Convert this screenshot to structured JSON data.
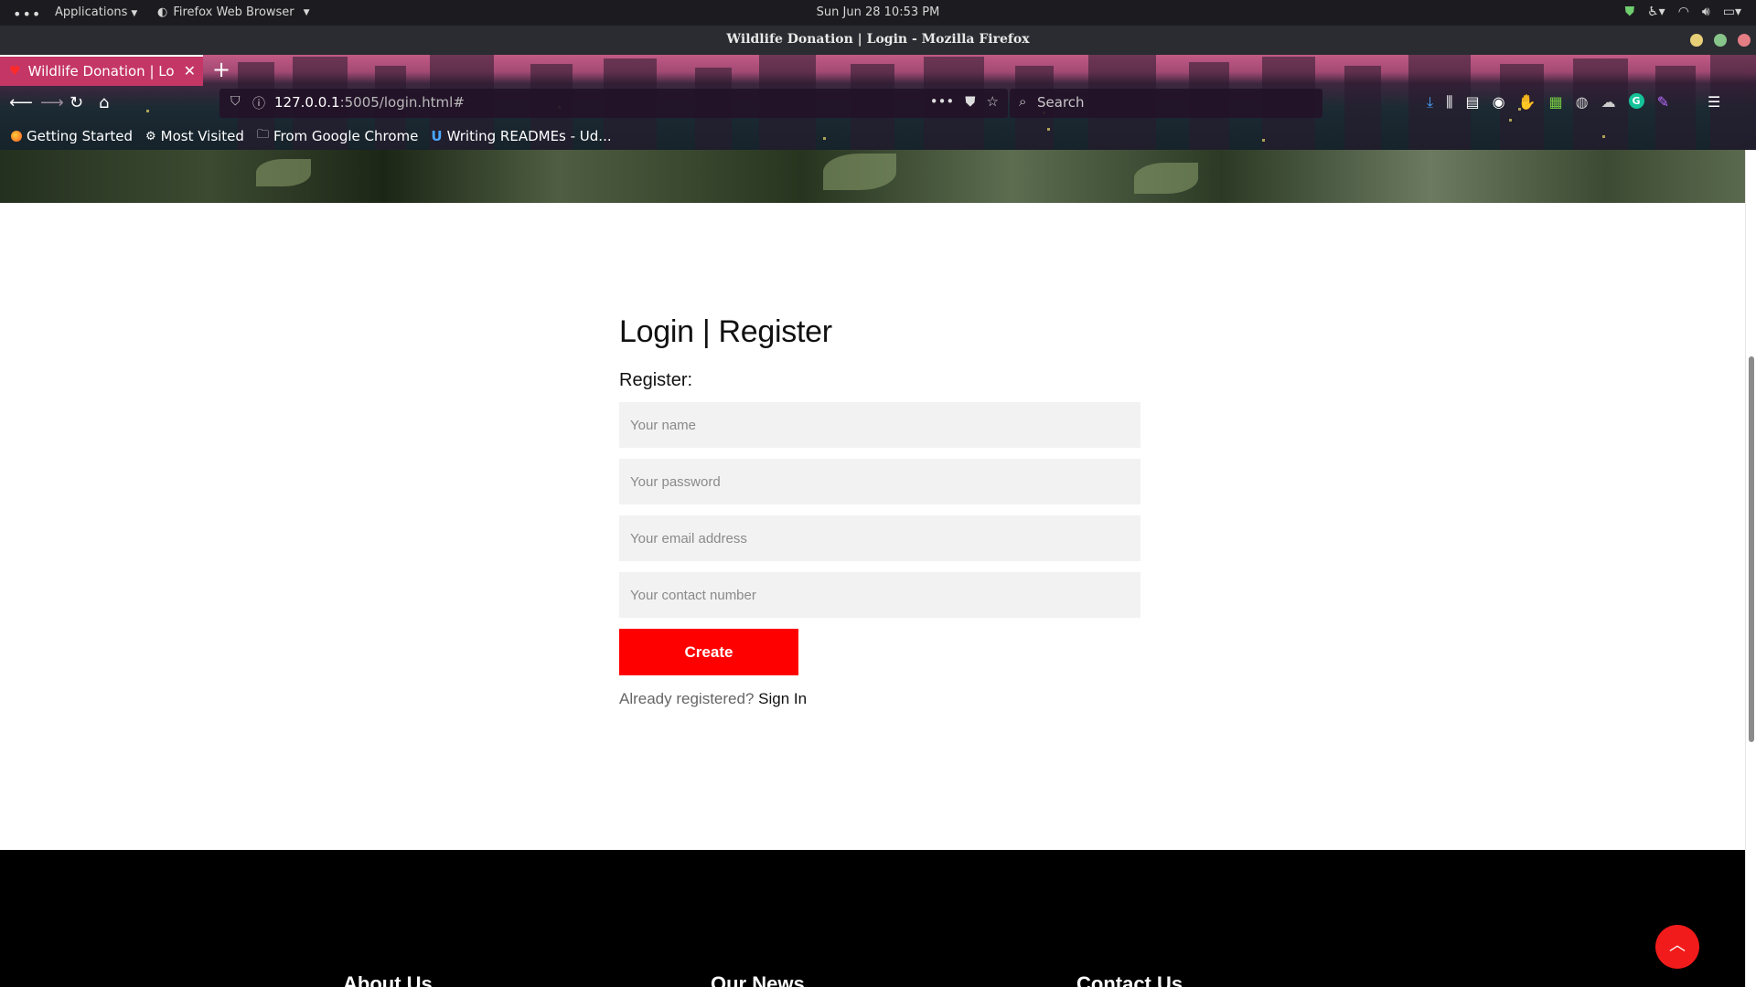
{
  "system_bar": {
    "activities": "•••",
    "applications": "Applications",
    "app_name": "Firefox Web Browser",
    "clock": "Sun Jun 28  10:53 PM"
  },
  "window": {
    "title": "Wildlife Donation | Login - Mozilla Firefox"
  },
  "browser": {
    "tab_title": "Wildlife Donation | Log",
    "url_host": "127.0.0.1",
    "url_rest": ":5005/login.html#",
    "search_placeholder": "Search",
    "bookmarks": [
      "Getting Started",
      "Most Visited",
      "From Google Chrome",
      "Writing READMEs - Ud..."
    ]
  },
  "page": {
    "heading": "Login | Register",
    "subheading": "Register:",
    "fields": {
      "name_placeholder": "Your name",
      "password_placeholder": "Your password",
      "email_placeholder": "Your email address",
      "contact_placeholder": "Your contact number"
    },
    "create_label": "Create",
    "already_text": "Already registered?",
    "signin_label": "Sign In"
  },
  "footer": {
    "columns": [
      "About Us",
      "Our News",
      "Contact Us"
    ]
  },
  "colors": {
    "accent_red": "#ff0000",
    "footer_bg": "#000000"
  }
}
